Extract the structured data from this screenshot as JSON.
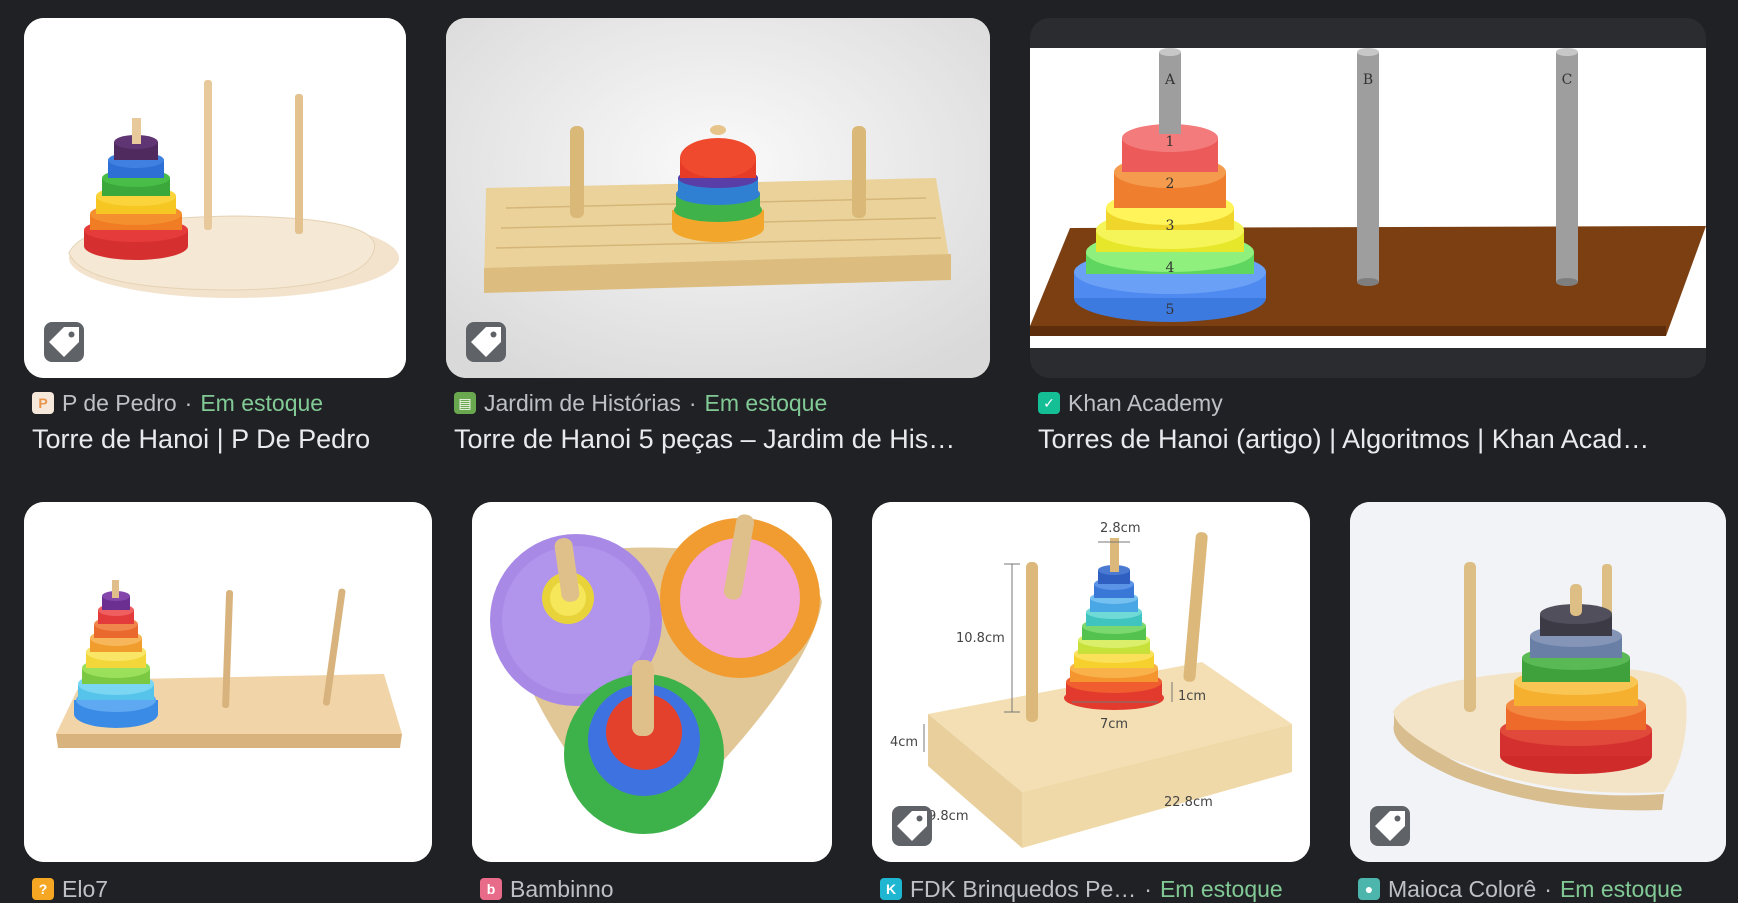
{
  "results": [
    {
      "source": "P de Pedro",
      "stock": "Em estoque",
      "title": "Torre de Hanoi | P De Pedro",
      "favicon": "p-letter-icon",
      "favicon_color": "#f7c6a3"
    },
    {
      "source": "Jardim de Histórias",
      "stock": "Em estoque",
      "title": "Torre de Hanoi 5 peças – Jardim de His…",
      "favicon": "book-icon",
      "favicon_color": "#6aa84f"
    },
    {
      "source": "Khan Academy",
      "stock": "",
      "title": "Torres de Hanoi (artigo) | Algoritmos | Khan Acad…",
      "favicon": "khan-leaf-icon",
      "favicon_color": "#14bf96"
    },
    {
      "source": "Elo7",
      "stock": "",
      "title": "",
      "favicon": "elo7-icon",
      "favicon_color": "#f5a623"
    },
    {
      "source": "Bambinno",
      "stock": "",
      "title": "",
      "favicon": "bambinno-icon",
      "favicon_color": "#e96b8a"
    },
    {
      "source": "FDK Brinquedos Pe…",
      "stock": "Em estoque",
      "title": "",
      "favicon": "k-letter-icon",
      "favicon_color": "#1fb6d1"
    },
    {
      "source": "Maioca Colorê",
      "stock": "Em estoque",
      "title": "",
      "favicon": "location-pin-icon",
      "favicon_color": "#4db6ac"
    }
  ],
  "illustration_labels": {
    "pegs": [
      "A",
      "B",
      "C"
    ],
    "disks": [
      "1",
      "2",
      "3",
      "4",
      "5"
    ],
    "dims": [
      "2.8cm",
      "10.8cm",
      "1cm",
      "7cm",
      "4cm",
      "9.8cm",
      "22.8cm"
    ]
  },
  "colors": {
    "background": "#202124",
    "in_stock": "#81c995",
    "tag_badge": "#5f6368"
  }
}
